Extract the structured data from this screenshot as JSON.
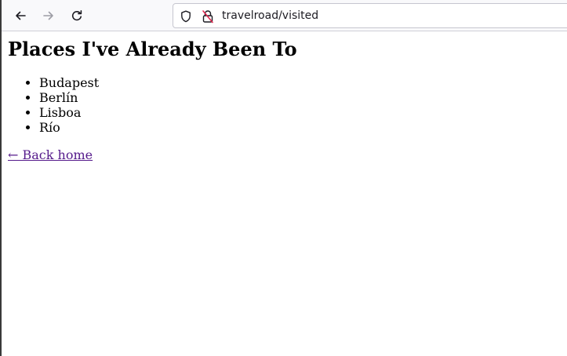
{
  "browser": {
    "url": "travelroad/visited",
    "icons": {
      "back": "arrow-left-icon",
      "forward": "arrow-right-icon",
      "reload": "reload-icon",
      "tracking": "shield-icon",
      "insecure": "insecure-lock-icon"
    }
  },
  "page": {
    "title": "Places I've Already Been To",
    "places": [
      "Budapest",
      "Berlín",
      "Lisboa",
      "Río"
    ],
    "back_link": "← Back home"
  },
  "colors": {
    "link_visited": "#551a8b",
    "toolbar_bg": "#f9f9fb",
    "insecure_slash": "#e22850"
  }
}
